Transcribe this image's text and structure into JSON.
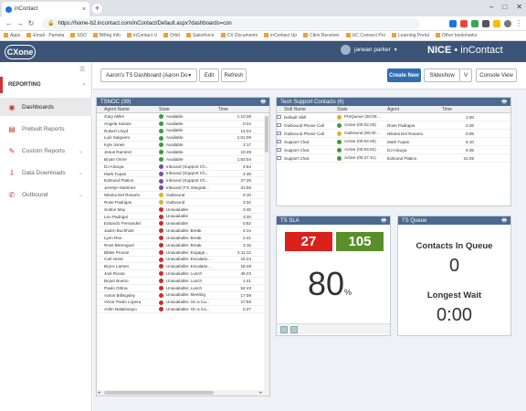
{
  "browser": {
    "tab_title": "inContact",
    "url": "https://home-b2.incontact.com/inContact/Default.aspx?dashboards=con",
    "bookmarks": [
      "Apps",
      "Email - Pamela",
      "SSO",
      "Billing Info",
      "inContact U",
      "Orbit",
      "Salesforce",
      "CX Documents",
      "inContact Up",
      "Citrix Receiver",
      "UC Connect Pro",
      "Learning Portal",
      "Other bookmarks"
    ]
  },
  "header": {
    "logo": "CXone",
    "user_name": "janean parker",
    "brand_main": "NICE",
    "brand_sub": "inContact"
  },
  "sidebar": {
    "section_label": "REPORTING",
    "items": [
      {
        "label": "Dashboards",
        "icon": "dashboard-icon"
      },
      {
        "label": "Prebuilt Reports",
        "icon": "report-icon"
      },
      {
        "label": "Custom Reports",
        "icon": "custom-report-icon"
      },
      {
        "label": "Data Downloads",
        "icon": "download-icon"
      },
      {
        "label": "Outbound",
        "icon": "phone-icon"
      }
    ]
  },
  "toolbar": {
    "dashboard_name": "Aaron's TS Dashboard (Aaron Do",
    "edit": "Edit",
    "refresh": "Refresh",
    "create_new": "Create New",
    "slideshow": "Slideshow",
    "slideshow_opt": "V",
    "console_view": "Console View"
  },
  "colors": {
    "available": "#3c9a3c",
    "unavailable": "#d02a2a",
    "inbound": "#7b4aa8",
    "outbound": "#d8b62a",
    "active": "#3c9a3c"
  },
  "tsnoc": {
    "title": "TSNOC (39)",
    "columns": [
      "Agent Name",
      "State",
      "Time"
    ],
    "rows": [
      {
        "agent": "Gary Miller",
        "state": "Available",
        "time": "1:10:39",
        "color": "#3c9a3c"
      },
      {
        "agent": "Angela Solaris",
        "state": "Available",
        "time": "0:24",
        "color": "#3c9a3c"
      },
      {
        "agent": "Robert Lloyd",
        "state": "Available",
        "time": "14:04",
        "color": "#3c9a3c"
      },
      {
        "agent": "Luis Salguero",
        "state": "Available",
        "time": "1:01:09",
        "color": "#3c9a3c"
      },
      {
        "agent": "Kyle Jones",
        "state": "Available",
        "time": "3:17",
        "color": "#3c9a3c"
      },
      {
        "agent": "Jesus Ramirez",
        "state": "Available",
        "time": "10:48",
        "color": "#3c9a3c"
      },
      {
        "agent": "Bryan Orme",
        "state": "Available",
        "time": "1:53:04",
        "color": "#3c9a3c"
      },
      {
        "agent": "DJ Alicaya",
        "state": "Inbound (Support Ch...",
        "time": "4:54",
        "color": "#7b4aa8"
      },
      {
        "agent": "Mark Tupas",
        "state": "Inbound (Support Ch...",
        "time": "4:49",
        "color": "#7b4aa8"
      },
      {
        "agent": "Edmund Platino",
        "state": "Inbound (Support Ch...",
        "time": "27:45",
        "color": "#7b4aa8"
      },
      {
        "agent": "Jenelyn Martinez",
        "state": "Inbound (TS Integrati...",
        "time": "31:56",
        "color": "#7b4aa8"
      },
      {
        "agent": "Nikolai Del Rosario",
        "state": "Outbound",
        "time": "0:10",
        "color": "#d8b62a"
      },
      {
        "agent": "Rose Padrajas",
        "state": "Outbound",
        "time": "3:32",
        "color": "#d8b62a"
      },
      {
        "agent": "Sutton May",
        "state": "Unavailable",
        "time": "3:40",
        "color": "#d02a2a"
      },
      {
        "agent": "Leo Padrigal",
        "state": "Unavailable",
        "time": "3:20",
        "color": "#d02a2a"
      },
      {
        "agent": "Eduardo Fernandez",
        "state": "Unavailable",
        "time": "0:52",
        "color": "#d02a2a"
      },
      {
        "agent": "Jaden Buchholz",
        "state": "Unavailable: Break",
        "time": "4:14",
        "color": "#d02a2a"
      },
      {
        "agent": "Lynn Roe",
        "state": "Unavailable: Break",
        "time": "2:41",
        "color": "#d02a2a"
      },
      {
        "agent": "Ross Berenguel",
        "state": "Unavailable: Break",
        "time": "3:16",
        "color": "#d02a2a"
      },
      {
        "agent": "Blake Prouse",
        "state": "Unavailable: Engage...",
        "time": "2:11:12",
        "color": "#d02a2a"
      },
      {
        "agent": "Carl Hurst",
        "state": "Unavailable: Escalatio...",
        "time": "15:24",
        "color": "#d02a2a"
      },
      {
        "agent": "Bryce Larsen",
        "state": "Unavailable: Escalatio...",
        "time": "18:49",
        "color": "#d02a2a"
      },
      {
        "agent": "Joel Rocas",
        "state": "Unavailable: Lunch",
        "time": "46:23",
        "color": "#d02a2a"
      },
      {
        "agent": "Bryan Bueno",
        "state": "Unavailable: Lunch",
        "time": "1:41",
        "color": "#d02a2a"
      },
      {
        "agent": "Paulo Ortina",
        "state": "Unavailable: Lunch",
        "time": "54:43",
        "color": "#d02a2a"
      },
      {
        "agent": "Aaron Billingsley",
        "state": "Unavailable: Meeting",
        "time": "17:09",
        "color": "#d02a2a"
      },
      {
        "agent": "Victor Paolo Lopera",
        "state": "Unavailable: On a Ca...",
        "time": "27:59",
        "color": "#d02a2a"
      },
      {
        "agent": "Arlen Balatinsayo",
        "state": "Unavailable: On a Ca...",
        "time": "0:27",
        "color": "#d02a2a"
      }
    ]
  },
  "ts_contacts": {
    "title": "Tech Support Contacts (6)",
    "columns": [
      "Skill Name",
      "State",
      "Agent",
      "Time"
    ],
    "rows": [
      {
        "skill": "Default Skill",
        "state": "PreQueue (00:00:...",
        "agent": "",
        "time": "1:00",
        "color": "#d8b62a"
      },
      {
        "skill": "Outbound Phone Call",
        "state": "Active (00:02:26)",
        "agent": "Rose Padrajas",
        "time": "2:26",
        "color": "#3c9a3c"
      },
      {
        "skill": "Outbound Phone Call",
        "state": "Outbound (00:00:...",
        "agent": "Nikolai Del Rosario",
        "time": "0:08",
        "color": "#d8b62a"
      },
      {
        "skill": "Support Chat",
        "state": "Active (00:04:45)",
        "agent": "Mark Tupas",
        "time": "5:10",
        "color": "#3c9a3c"
      },
      {
        "skill": "Support Chat",
        "state": "Active (00:04:52)",
        "agent": "DJ Alicaya",
        "time": "9:36",
        "color": "#3c9a3c"
      },
      {
        "skill": "Support Chat",
        "state": "Active (00:27:41)",
        "agent": "Edmund Platino",
        "time": "31:05",
        "color": "#3c9a3c"
      }
    ]
  },
  "sla": {
    "title": "TS SLA",
    "out_of_sla": "27",
    "in_sla": "105",
    "percent": "80",
    "percent_symbol": "%",
    "red": "#d9221c",
    "green": "#5a8e2a"
  },
  "queue": {
    "title": "TS Queue",
    "contacts_label": "Contacts In Queue",
    "contacts_value": "0",
    "wait_label": "Longest Wait",
    "wait_value": "0:00"
  }
}
